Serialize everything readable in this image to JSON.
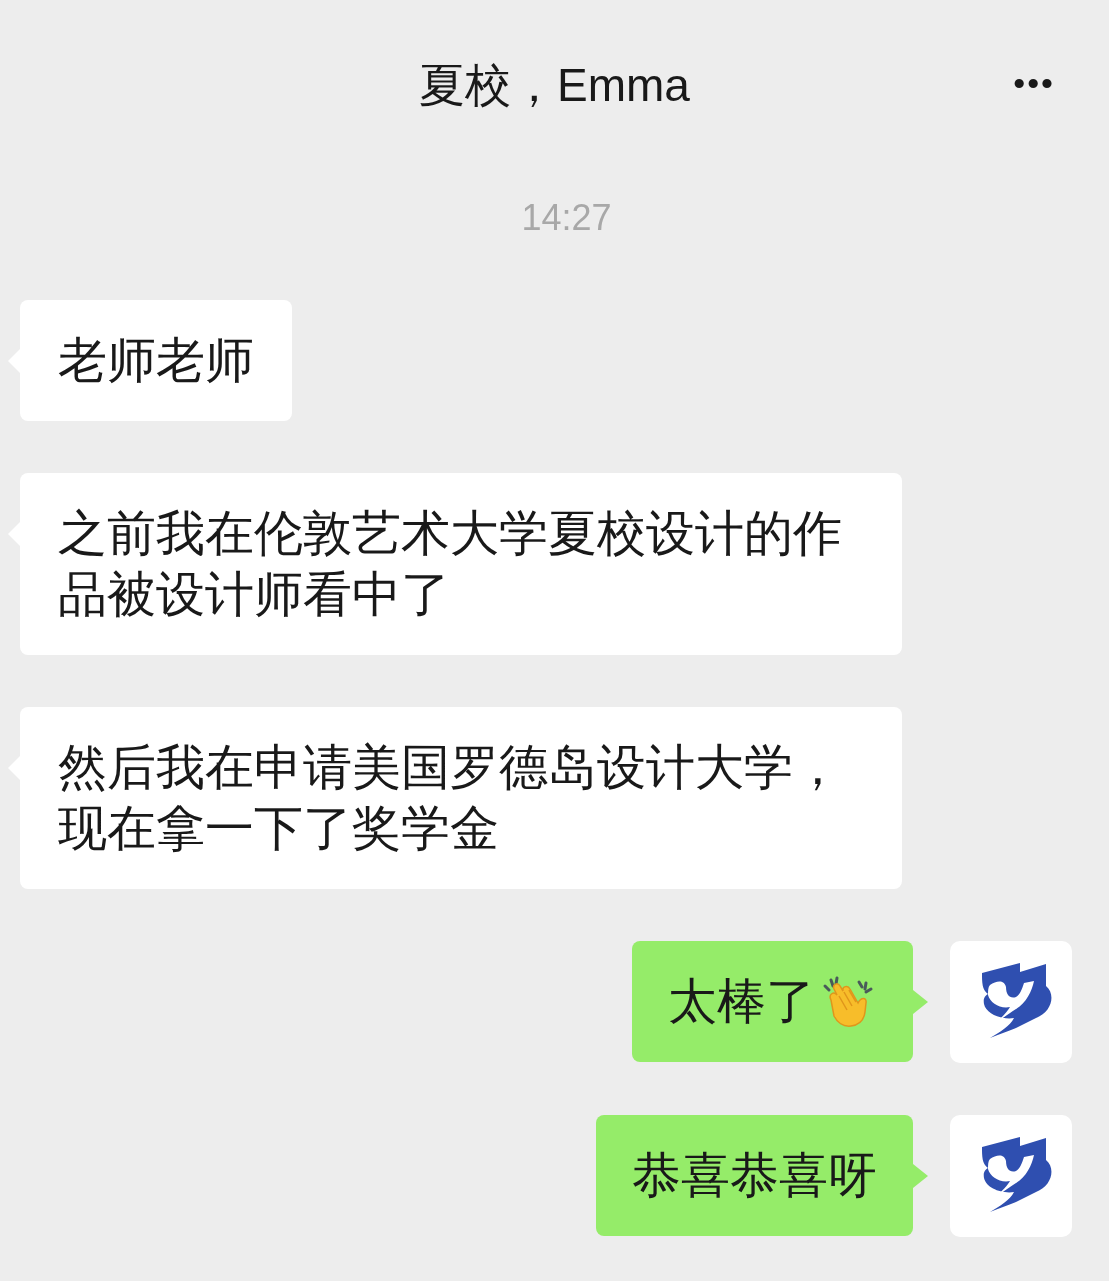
{
  "header": {
    "title": "夏校，Emma",
    "menu": "•••"
  },
  "timestamp": "14:27",
  "messages": [
    {
      "kind": "received",
      "text": "老师老师"
    },
    {
      "kind": "received",
      "text": "之前我在伦敦艺术大学夏校设计的作品被设计师看中了"
    },
    {
      "kind": "received",
      "text": "然后我在申请美国罗德岛设计大学，现在拿一下了奖学金"
    },
    {
      "kind": "sent",
      "text": "太棒了",
      "emoji": true
    },
    {
      "kind": "sent",
      "text": "恭喜恭喜呀"
    }
  ]
}
